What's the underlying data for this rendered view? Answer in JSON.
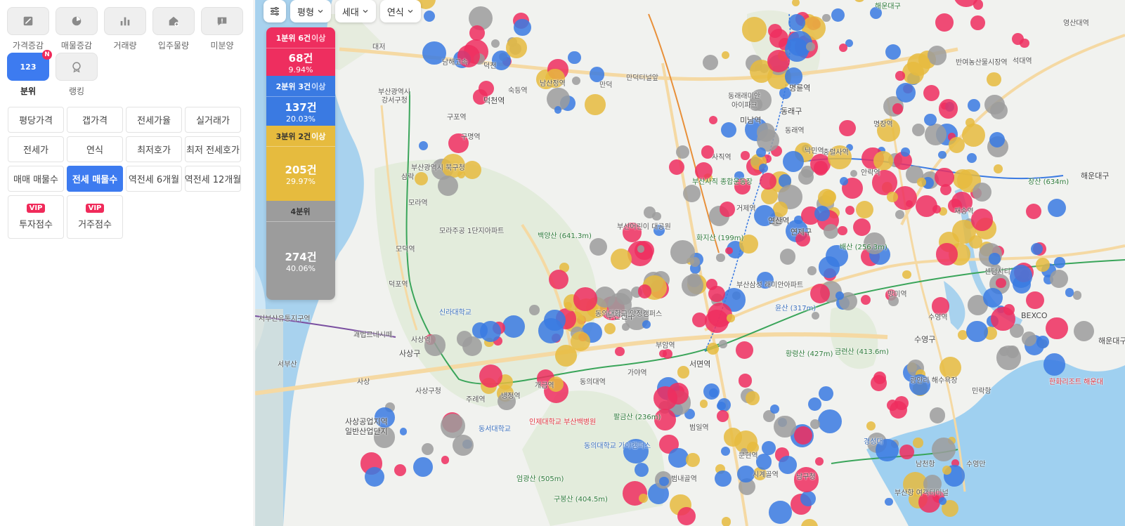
{
  "sidebar": {
    "categories": [
      {
        "label": "가격증감",
        "icon": "price-change-icon"
      },
      {
        "label": "매물증감",
        "icon": "listing-change-icon"
      },
      {
        "label": "거래량",
        "icon": "bar-chart-icon"
      },
      {
        "label": "입주물량",
        "icon": "house-add-icon"
      },
      {
        "label": "미분양",
        "icon": "unsold-alert-icon"
      },
      {
        "label": "분위",
        "icon": "quantile-123-icon",
        "icon_text": "123",
        "badge": "N"
      },
      {
        "label": "랭킹",
        "icon": "ranking-medal-icon"
      }
    ],
    "options": [
      {
        "label": "평당가격"
      },
      {
        "label": "갭가격"
      },
      {
        "label": "전세가율"
      },
      {
        "label": "실거래가"
      },
      {
        "label": "전세가"
      },
      {
        "label": "연식"
      },
      {
        "label": "최저호가"
      },
      {
        "label": "최저 전세호가"
      },
      {
        "label": "매매 매물수"
      },
      {
        "label": "전세 매물수"
      },
      {
        "label": "역전세 6개월"
      },
      {
        "label": "역전세 12개월"
      }
    ],
    "vip_options": [
      {
        "badge": "VIP",
        "label": "투자점수"
      },
      {
        "badge": "VIP",
        "label": "거주점수"
      }
    ]
  },
  "filters": [
    {
      "label": "평형"
    },
    {
      "label": "세대"
    },
    {
      "label": "연식"
    }
  ],
  "legend": [
    {
      "head": "1분위 6건",
      "suffix": "이상",
      "count": "68건",
      "pct": "9.94%",
      "color": "#ee2e5f"
    },
    {
      "head": "2분위 3건",
      "suffix": "이상",
      "count": "137건",
      "pct": "20.03%",
      "color": "#3a7ae2"
    },
    {
      "head": "3분위 2건",
      "suffix": "이상",
      "count": "205건",
      "pct": "29.97%",
      "color": "#e6bb3e"
    },
    {
      "head": "4분위",
      "suffix": "",
      "count": "274건",
      "pct": "40.06%",
      "color": "#9c9c9c"
    }
  ],
  "map_labels": [
    "대저",
    "덕천",
    "남해고속",
    "숙등역",
    "남산정역",
    "만덕",
    "만덕터널앞",
    "동래래미안",
    "아이파크",
    "미남역",
    "명륜역",
    "동래구",
    "동래역",
    "구포역",
    "구명역",
    "덕천역",
    "부산광역시",
    "강서구청",
    "부산광역시 북구청",
    "삼락",
    "모라역",
    "모라주공 1단지아파트",
    "모덕역",
    "덕포역",
    "백양산 (641.3m)",
    "부산어린이 대공원",
    "신라대학교",
    "괘법르네시떼",
    "사상역",
    "사상구",
    "사상구청",
    "사상공업지역",
    "일반산업단지",
    "서부산유통지구역",
    "서부산",
    "사상",
    "주례역",
    "냉정역",
    "개금역",
    "동의대역",
    "가야역",
    "부암역",
    "서면역",
    "인제대학교 부산백병원",
    "동서대학교",
    "동의대학교 가야캠퍼스",
    "엄광산 (505m)",
    "구봉산 (404.5m)",
    "팔금산 (236m)",
    "황령산 (427m)",
    "금련산 (413.6m)",
    "부산진구",
    "화지산 (199m)",
    "연산역",
    "연제구",
    "거제역",
    "배산 (256.3m)",
    "망미역",
    "수영역",
    "수영구",
    "광안리 해수욕장",
    "민락항",
    "남천항",
    "수영만",
    "BEXCO",
    "한화리조트 해운대",
    "해운대구",
    "장산 (634m)",
    "해운대구",
    "재송역",
    "센텀시티",
    "명장역",
    "안락역",
    "충렬사역",
    "낙민역",
    "부산사직 종합운동장",
    "사직역",
    "범일역",
    "문현역",
    "범내골역",
    "경성대",
    "남구청",
    "시계골역",
    "부산항 여객터미널",
    "석대역",
    "반여농산물시장역",
    "영산대역",
    "해운대구",
    "윤산 (317m)",
    "동의대학교 양정캠퍼스",
    "부산삼성 래미안아파트",
    "양정역",
    "서면",
    "백양산"
  ]
}
